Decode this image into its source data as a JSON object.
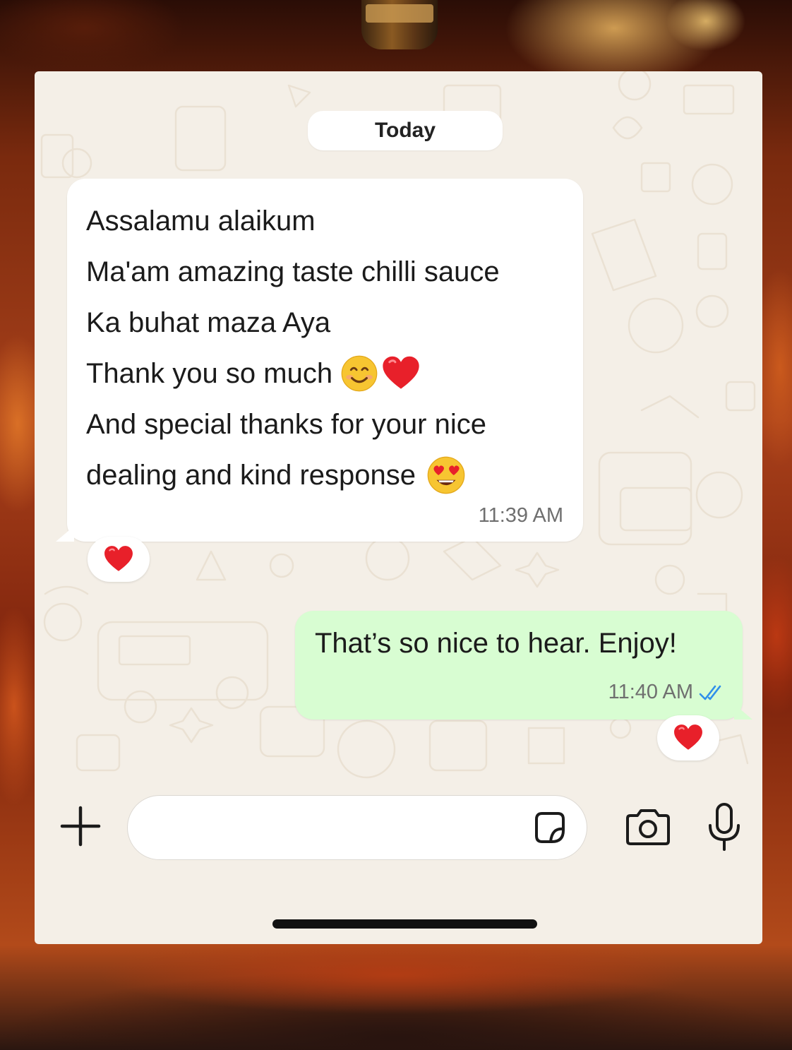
{
  "conversation": {
    "date_separator": "Today"
  },
  "incoming_message": {
    "lines": [
      {
        "text": "Assalamu alaikum",
        "emojis": []
      },
      {
        "text": "Ma'am amazing taste chilli sauce",
        "emojis": []
      },
      {
        "text": "Ka buhat maza Aya",
        "emojis": []
      },
      {
        "text": "Thank you so much",
        "emojis": [
          "smiling-face-icon",
          "red-heart-icon"
        ]
      },
      {
        "text": "And special thanks for your nice",
        "emojis": []
      },
      {
        "text": "dealing and kind response",
        "emojis": [
          "heart-eyes-face-icon"
        ]
      }
    ],
    "time": "11:39 AM",
    "reaction": "red-heart-icon"
  },
  "outgoing_message": {
    "text": "That’s so nice to hear. Enjoy!",
    "time": "11:40 AM",
    "status": "read-double-check-icon",
    "reaction": "red-heart-icon"
  },
  "composer": {
    "placeholder": "",
    "value": "",
    "icons": [
      "plus-icon",
      "sticker-icon",
      "camera-icon",
      "microphone-icon"
    ]
  },
  "colors": {
    "chat_background": "#f4efe7",
    "incoming_bubble": "#ffffff",
    "outgoing_bubble": "#d8fdd2",
    "read_tick": "#2f8fea",
    "heart": "#e8202a"
  }
}
